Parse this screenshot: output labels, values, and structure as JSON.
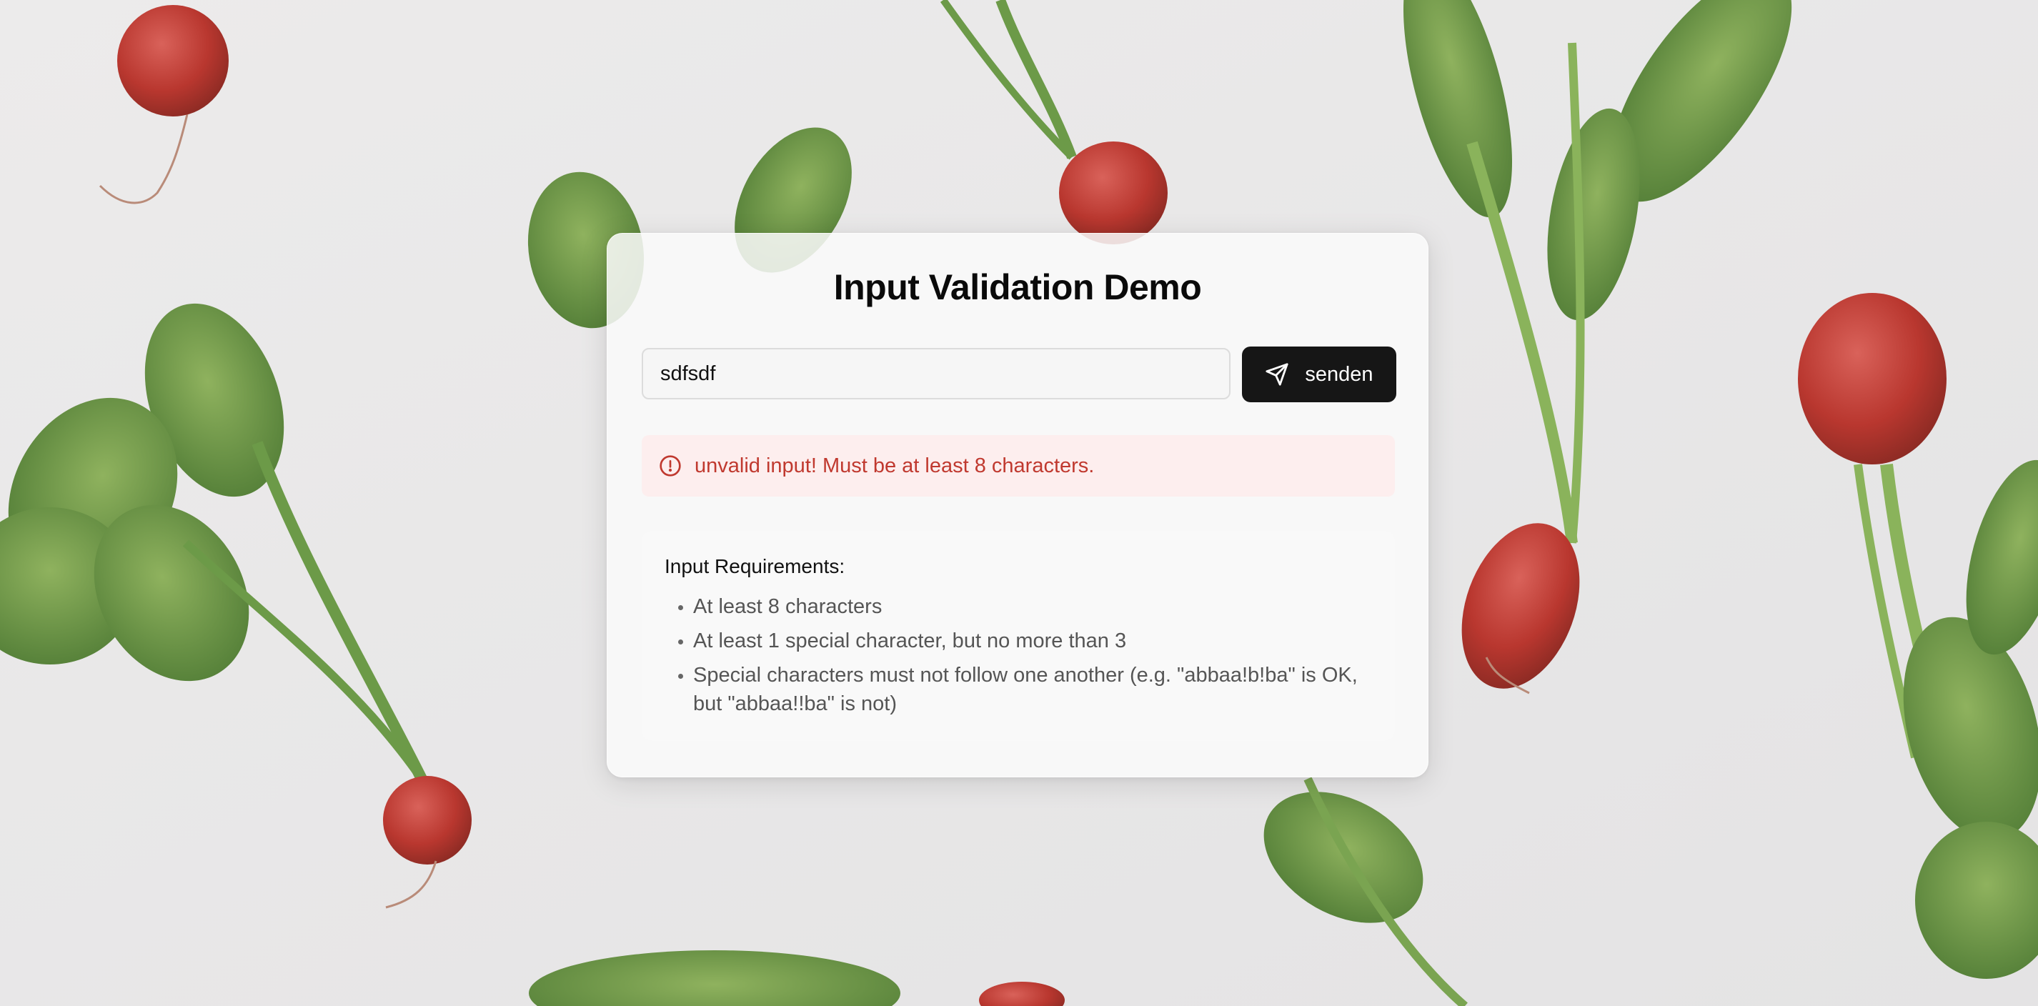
{
  "card": {
    "title": "Input Validation Demo"
  },
  "form": {
    "input_value": "sdfsdf",
    "submit_label": "senden",
    "submit_icon": "send-icon"
  },
  "error": {
    "icon": "alert-circle-icon",
    "message": "unvalid input! Must be at least 8 characters.",
    "color": "#c0392f",
    "background": "#fdeeee"
  },
  "requirements": {
    "title": "Input Requirements:",
    "items": [
      "At least 8 characters",
      "At least 1 special character, but no more than 3",
      "Special characters must not follow one another (e.g. \"abbaa!b!ba\" is OK, but \"abbaa!!ba\" is not)"
    ]
  },
  "theme": {
    "button_color": "#161616",
    "card_background": "#fafafa"
  }
}
